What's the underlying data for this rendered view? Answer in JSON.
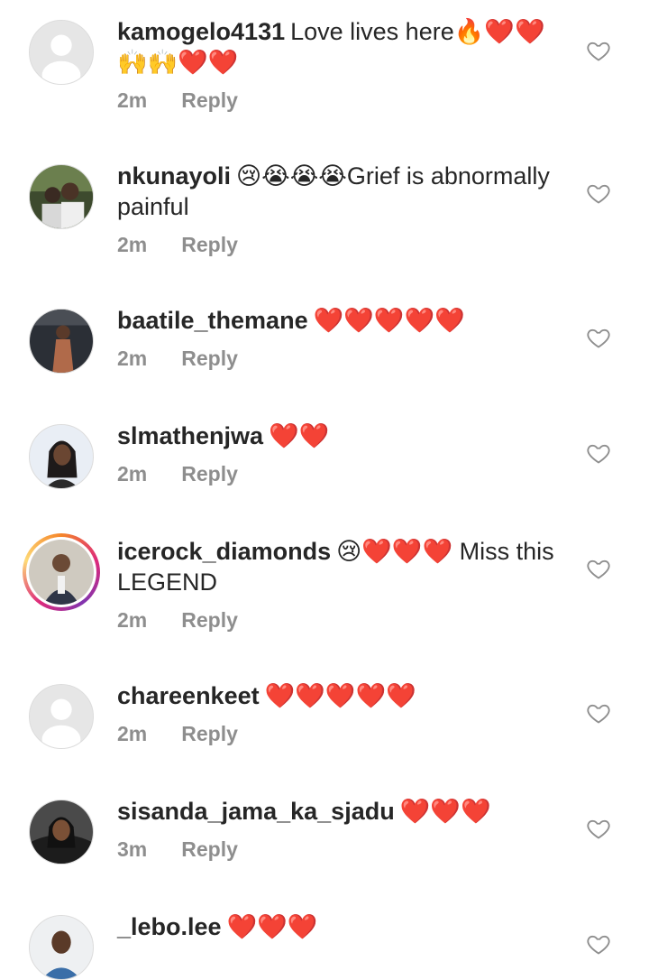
{
  "comments": [
    {
      "user": "kamogelo4131",
      "text": "Love lives here🔥❤️❤️🙌🙌❤️❤️",
      "time": "2m",
      "reply": "Reply",
      "avatar": "placeholder-avatar-icon"
    },
    {
      "user": "nkunayoli",
      "text": "😢😭😭😭Grief is abnormally painful",
      "time": "2m",
      "reply": "Reply",
      "avatar": "user-photo"
    },
    {
      "user": "baatile_themane",
      "text": "❤️❤️❤️❤️❤️",
      "time": "2m",
      "reply": "Reply",
      "avatar": "user-photo"
    },
    {
      "user": "slmathenjwa",
      "text": "❤️❤️",
      "time": "2m",
      "reply": "Reply",
      "avatar": "user-photo"
    },
    {
      "user": "icerock_diamonds",
      "text": "😢❤️❤️❤️ Miss this LEGEND",
      "time": "2m",
      "reply": "Reply",
      "avatar": "user-photo-story-ring"
    },
    {
      "user": "chareenkeet",
      "text": "❤️❤️❤️❤️❤️",
      "time": "2m",
      "reply": "Reply",
      "avatar": "placeholder-avatar-icon"
    },
    {
      "user": "sisanda_jama_ka_sjadu",
      "text": "❤️❤️❤️",
      "time": "3m",
      "reply": "Reply",
      "avatar": "user-photo"
    },
    {
      "user": "_lebo.lee",
      "text": "❤️❤️❤️",
      "time": "",
      "reply": "",
      "avatar": "user-photo"
    }
  ],
  "colors": {
    "meta": "#8e8e8e",
    "text": "#262626",
    "heart_outline": "#8e8e8e"
  },
  "icons": {
    "like": "heart-outline-icon"
  }
}
